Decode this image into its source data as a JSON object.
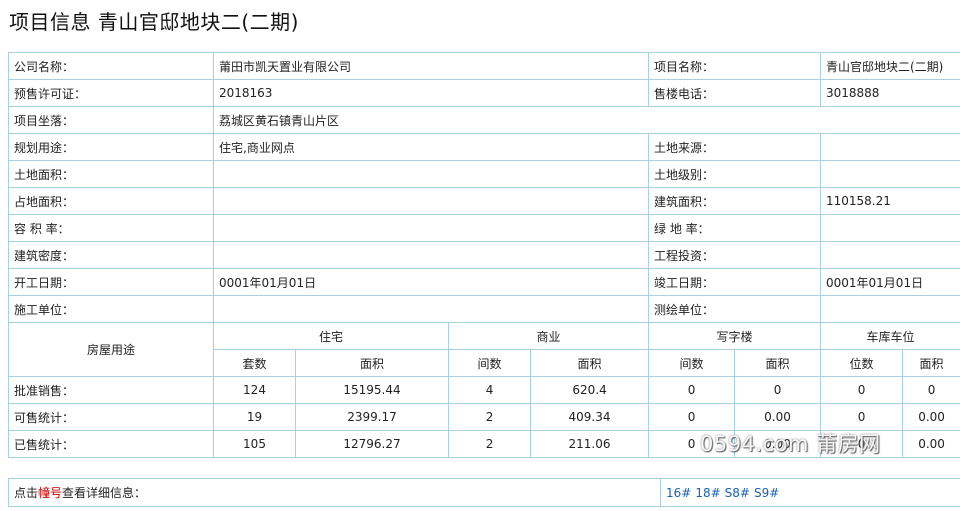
{
  "page": {
    "title": "项目信息 青山官邸地块二(二期)"
  },
  "info": [
    [
      "公司名称：",
      "莆田市凯天置业有限公司",
      "项目名称：",
      "青山官邸地块二(二期)"
    ],
    [
      "预售许可证：",
      "2018163",
      "售楼电话：",
      "3018888"
    ],
    [
      "项目坐落：",
      "荔城区黄石镇青山片区",
      "",
      ""
    ],
    [
      "规划用途：",
      "住宅,商业网点",
      "土地来源：",
      ""
    ],
    [
      "土地面积：",
      "",
      "土地级别：",
      ""
    ],
    [
      "占地面积：",
      "",
      "建筑面积：",
      "110158.21"
    ],
    [
      "容 积 率：",
      "",
      "绿 地 率：",
      ""
    ],
    [
      "建筑密度：",
      "",
      "工程投资：",
      ""
    ],
    [
      "开工日期：",
      "0001年01月01日",
      "竣工日期：",
      "0001年01月01日"
    ],
    [
      "施工单位：",
      "",
      "测绘单位：",
      ""
    ]
  ],
  "stats": {
    "row_header": "房屋用途",
    "groups": [
      "住宅",
      "商业",
      "写字楼",
      "车库车位"
    ],
    "subheaders": [
      "套数",
      "面积",
      "间数",
      "面积",
      "间数",
      "面积",
      "位数",
      "面积"
    ],
    "rows": [
      {
        "label": "批准销售：",
        "values": [
          "124",
          "15195.44",
          "4",
          "620.4",
          "0",
          "0",
          "0",
          "0"
        ]
      },
      {
        "label": "可售统计：",
        "values": [
          "19",
          "2399.17",
          "2",
          "409.34",
          "0",
          "0.00",
          "0",
          "0.00"
        ]
      },
      {
        "label": "已售统计：",
        "values": [
          "105",
          "12796.27",
          "2",
          "211.06",
          "0",
          "0.00",
          "0",
          "0.00"
        ]
      }
    ]
  },
  "footer": {
    "hint_prefix": "点击",
    "hint_highlight": "幢号",
    "hint_suffix": "查看详细信息：",
    "buildings": [
      "16#",
      "18#",
      "S8#",
      "S9#"
    ]
  },
  "watermark": "0594.com 莆房网"
}
